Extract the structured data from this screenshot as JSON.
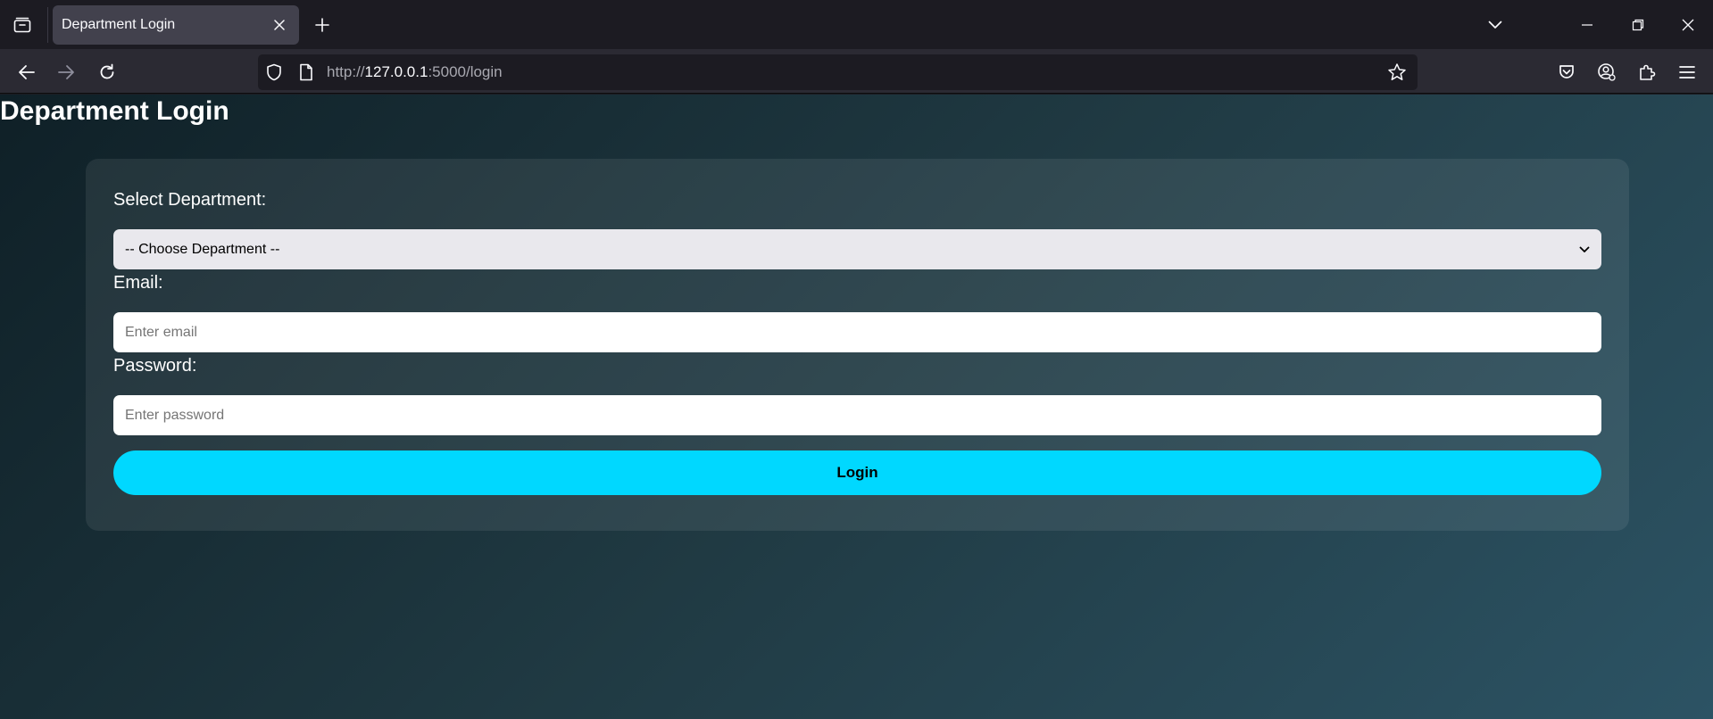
{
  "browser": {
    "tab_title": "Department Login",
    "url_scheme": "http://",
    "url_host": "127.0.0.1",
    "url_rest": ":5000/login"
  },
  "page": {
    "title": "Department Login",
    "department_label": "Select Department:",
    "department_selected": "-- Choose Department --",
    "email_label": "Email:",
    "email_placeholder": "Enter email",
    "password_label": "Password:",
    "password_placeholder": "Enter password",
    "login_label": "Login"
  },
  "colors": {
    "accent": "#00d8ff",
    "background_start": "#0f2027",
    "background_end": "#2c5364"
  }
}
